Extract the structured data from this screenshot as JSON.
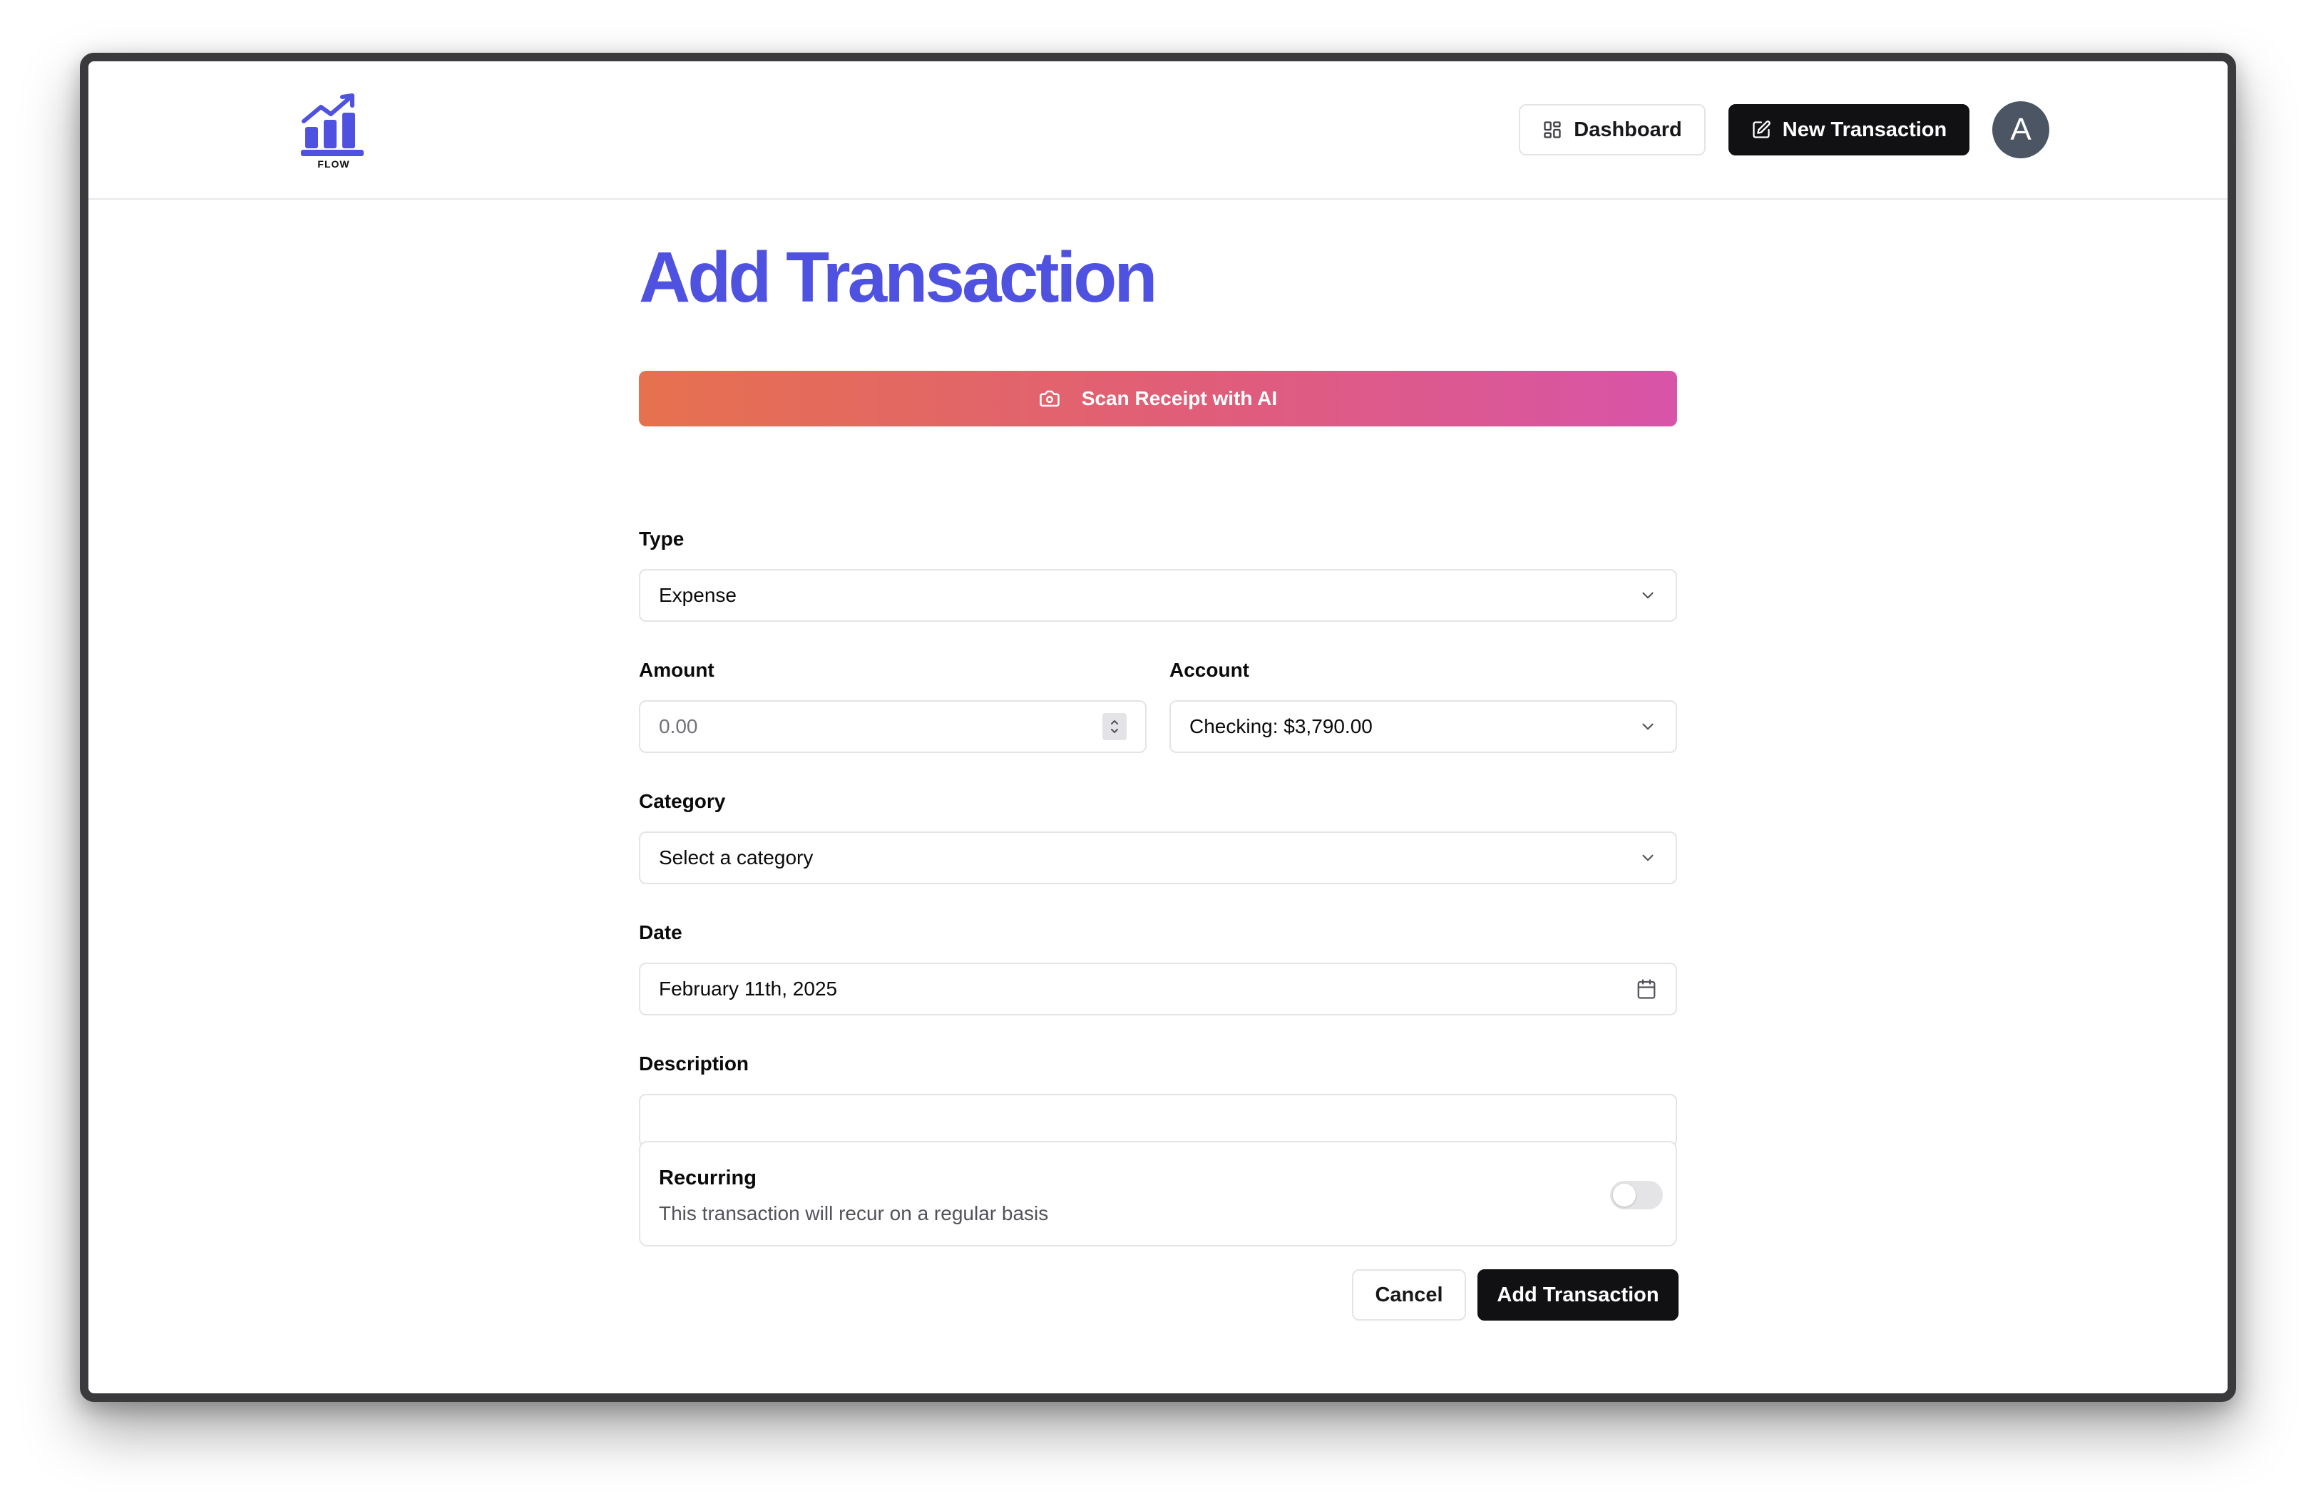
{
  "header": {
    "logo_text": "FLOW",
    "dashboard_label": "Dashboard",
    "new_transaction_label": "New Transaction",
    "avatar_initial": "A"
  },
  "page": {
    "title": "Add Transaction",
    "scan_label": "Scan Receipt with AI"
  },
  "form": {
    "type": {
      "label": "Type",
      "value": "Expense"
    },
    "amount": {
      "label": "Amount",
      "placeholder": "0.00"
    },
    "account": {
      "label": "Account",
      "value": "Checking: $3,790.00"
    },
    "category": {
      "label": "Category",
      "value": "Select a category"
    },
    "date": {
      "label": "Date",
      "value": "February 11th, 2025"
    },
    "description": {
      "label": "Description",
      "value": ""
    },
    "recurring": {
      "title": "Recurring",
      "description": "This transaction will recur on a regular basis",
      "enabled": false
    }
  },
  "actions": {
    "cancel_label": "Cancel",
    "submit_label": "Add Transaction"
  },
  "colors": {
    "brand": "#4f52e0",
    "dark": "#111113",
    "border": "#e4e4e7",
    "gradient_start": "#e6714e",
    "gradient_end": "#d854a8"
  },
  "icons": {
    "logo": "chart-growth-icon",
    "dashboard": "grid-icon",
    "new_transaction": "pen-square-icon",
    "scan": "camera-icon",
    "select": "chevron-down-icon",
    "date": "calendar-icon"
  }
}
